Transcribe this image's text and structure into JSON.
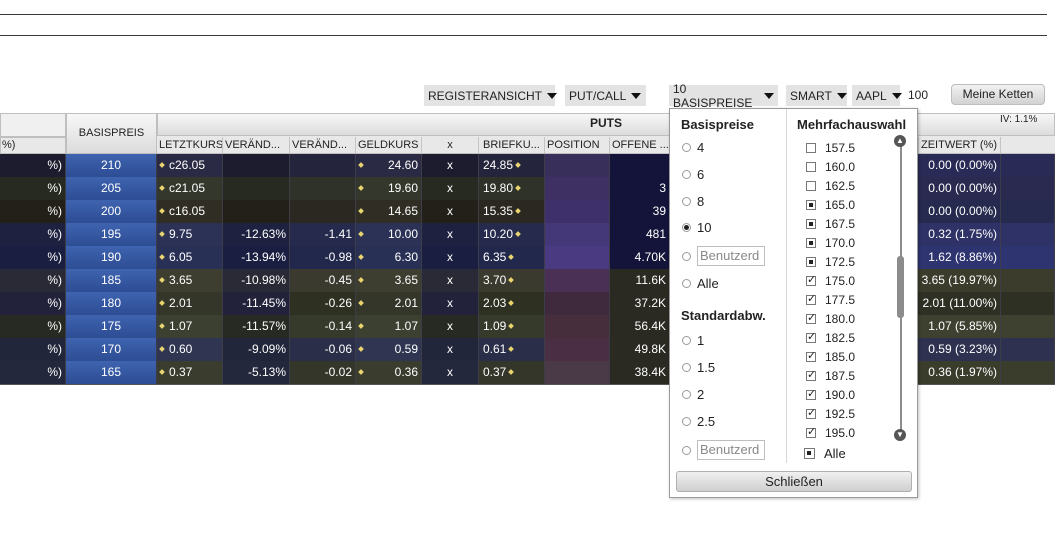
{
  "toolbar": {
    "view": "REGISTERANSICHT",
    "putcall": "PUT/CALL",
    "strikes": "10 BASISPREISE",
    "exchange": "SMART",
    "symbol": "AAPL",
    "quantity": "100",
    "chains_button": "Meine Ketten"
  },
  "table": {
    "left_header": "%)",
    "strike_header": "BASISPREIS",
    "puts_label": "PUTS",
    "iv": "IV: 1.1%",
    "columns": [
      "LETZTKURS",
      "VERÄND...",
      "VERÄND...",
      "GELDKURS",
      "x",
      "BRIEFKU...",
      "POSITION",
      "OFFENE ..."
    ],
    "time_value_header": "ZEITWERT (%)",
    "rows": [
      {
        "left": "%)",
        "strike": "210",
        "last": "c26.05",
        "chg_pct": "",
        "chg": "",
        "bid": "24.60",
        "x": "x",
        "ask": "24.85",
        "oi": "",
        "tv": "0.00 (0.00%)"
      },
      {
        "left": "%)",
        "strike": "205",
        "last": "c21.05",
        "chg_pct": "",
        "chg": "",
        "bid": "19.60",
        "x": "x",
        "ask": "19.80",
        "oi": "3",
        "tv": "0.00 (0.00%)"
      },
      {
        "left": "%)",
        "strike": "200",
        "last": "c16.05",
        "chg_pct": "",
        "chg": "",
        "bid": "14.65",
        "x": "x",
        "ask": "15.35",
        "oi": "39",
        "tv": "0.00 (0.00%)"
      },
      {
        "left": "%)",
        "strike": "195",
        "last": "9.75",
        "chg_pct": "-12.63%",
        "chg": "-1.41",
        "bid": "10.00",
        "x": "x",
        "ask": "10.20",
        "oi": "481",
        "tv": "0.32 (1.75%)"
      },
      {
        "left": "%)",
        "strike": "190",
        "last": "6.05",
        "chg_pct": "-13.94%",
        "chg": "-0.98",
        "bid": "6.30",
        "x": "x",
        "ask": "6.35",
        "oi": "4.70K",
        "tv": "1.62 (8.86%)"
      },
      {
        "left": "%)",
        "strike": "185",
        "last": "3.65",
        "chg_pct": "-10.98%",
        "chg": "-0.45",
        "bid": "3.65",
        "x": "x",
        "ask": "3.70",
        "oi": "11.6K",
        "tv": "3.65 (19.97%)"
      },
      {
        "left": "%)",
        "strike": "180",
        "last": "2.01",
        "chg_pct": "-11.45%",
        "chg": "-0.26",
        "bid": "2.01",
        "x": "x",
        "ask": "2.03",
        "oi": "37.2K",
        "tv": "2.01 (11.00%)"
      },
      {
        "left": "%)",
        "strike": "175",
        "last": "1.07",
        "chg_pct": "-11.57%",
        "chg": "-0.14",
        "bid": "1.07",
        "x": "x",
        "ask": "1.09",
        "oi": "56.4K",
        "tv": "1.07 (5.85%)"
      },
      {
        "left": "%)",
        "strike": "170",
        "last": "0.60",
        "chg_pct": "-9.09%",
        "chg": "-0.06",
        "bid": "0.59",
        "x": "x",
        "ask": "0.61",
        "oi": "49.8K",
        "tv": "0.59 (3.23%)"
      },
      {
        "left": "%)",
        "strike": "165",
        "last": "0.37",
        "chg_pct": "-5.13%",
        "chg": "-0.02",
        "bid": "0.36",
        "x": "x",
        "ask": "0.37",
        "oi": "38.4K",
        "tv": "0.36 (1.97%)"
      }
    ]
  },
  "popup": {
    "basis_title": "Basispreise",
    "basis_options": [
      "4",
      "6",
      "8",
      "10"
    ],
    "basis_selected": "10",
    "custom_placeholder": "Benutzerd",
    "all_label": "Alle",
    "std_title": "Standardabw.",
    "std_options": [
      "1",
      "1.5",
      "2",
      "2.5"
    ],
    "multi_title": "Mehrfachauswahl",
    "multi_items": [
      {
        "label": "157.5",
        "state": "empty"
      },
      {
        "label": "160.0",
        "state": "empty"
      },
      {
        "label": "162.5",
        "state": "empty"
      },
      {
        "label": "165.0",
        "state": "partial"
      },
      {
        "label": "167.5",
        "state": "partial"
      },
      {
        "label": "170.0",
        "state": "partial"
      },
      {
        "label": "172.5",
        "state": "partial"
      },
      {
        "label": "175.0",
        "state": "checked"
      },
      {
        "label": "177.5",
        "state": "checked"
      },
      {
        "label": "180.0",
        "state": "checked"
      },
      {
        "label": "182.5",
        "state": "checked"
      },
      {
        "label": "185.0",
        "state": "checked"
      },
      {
        "label": "187.5",
        "state": "checked"
      },
      {
        "label": "190.0",
        "state": "checked"
      },
      {
        "label": "192.5",
        "state": "checked"
      },
      {
        "label": "195.0",
        "state": "checked"
      }
    ],
    "multi_all_label": "Alle",
    "close_label": "Schließen"
  }
}
